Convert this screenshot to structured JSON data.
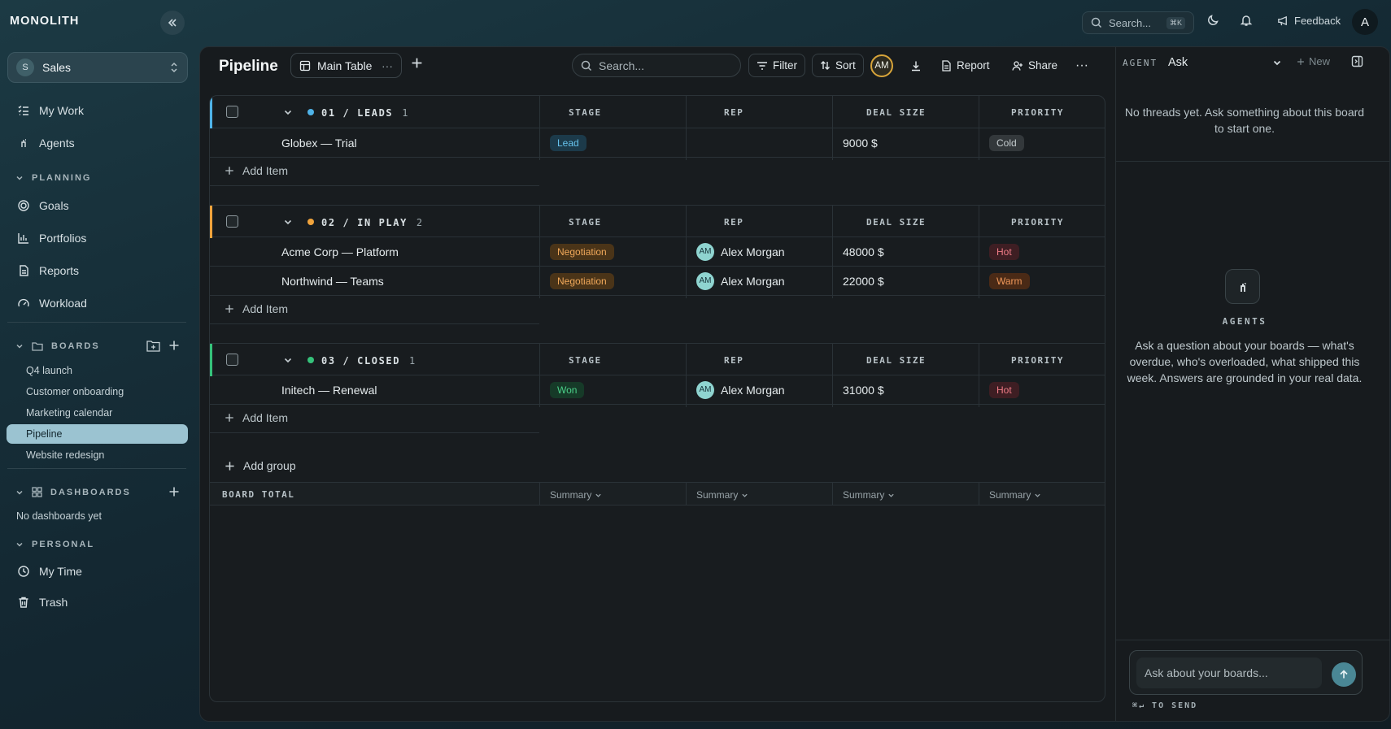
{
  "app": {
    "brand": "MONOLITH"
  },
  "topbar": {
    "search_label": "Search...",
    "search_kbd": "⌘K",
    "feedback": "Feedback",
    "user_initial": "A"
  },
  "sidebar": {
    "workspace": {
      "initial": "S",
      "name": "Sales"
    },
    "nav": [
      {
        "label": "My Work",
        "icon": "list-check-icon"
      },
      {
        "label": "Agents",
        "icon": "agent-icon"
      }
    ],
    "planning": {
      "title": "PLANNING",
      "items": [
        {
          "label": "Goals",
          "icon": "target-icon"
        },
        {
          "label": "Portfolios",
          "icon": "bar-chart-icon"
        },
        {
          "label": "Reports",
          "icon": "document-icon"
        },
        {
          "label": "Workload",
          "icon": "gauge-icon"
        }
      ]
    },
    "boards": {
      "title": "BOARDS",
      "items": [
        "Q4 launch",
        "Customer onboarding",
        "Marketing calendar",
        "Pipeline",
        "Website redesign"
      ],
      "active": "Pipeline"
    },
    "dashboards": {
      "title": "DASHBOARDS",
      "empty": "No dashboards yet"
    },
    "personal": {
      "title": "PERSONAL",
      "items": [
        {
          "label": "My Time",
          "icon": "clock-icon"
        },
        {
          "label": "Trash",
          "icon": "trash-icon"
        }
      ]
    }
  },
  "toolbar": {
    "title": "Pipeline",
    "view": "Main Table",
    "search_placeholder": "Search...",
    "filter": "Filter",
    "sort": "Sort",
    "person_filter": "AM",
    "report": "Report",
    "share": "Share"
  },
  "board": {
    "columns": [
      "STAGE",
      "REP",
      "DEAL SIZE",
      "PRIORITY"
    ],
    "add_item": "Add Item",
    "add_group": "Add group",
    "total_label": "BOARD TOTAL",
    "summary_label": "Summary",
    "groups": [
      {
        "name": "01 / LEADS",
        "count": "1",
        "color": "#4fb3e8",
        "rows": [
          {
            "item": "Globex — Trial",
            "stage": "Lead",
            "rep": "",
            "rep_initials": "",
            "deal": "9000 $",
            "priority": "Cold"
          }
        ]
      },
      {
        "name": "02 / IN PLAY",
        "count": "2",
        "color": "#f0a33c",
        "rows": [
          {
            "item": "Acme Corp — Platform",
            "stage": "Negotiation",
            "rep": "Alex Morgan",
            "rep_initials": "AM",
            "deal": "48000 $",
            "priority": "Hot"
          },
          {
            "item": "Northwind — Teams",
            "stage": "Negotiation",
            "rep": "Alex Morgan",
            "rep_initials": "AM",
            "deal": "22000 $",
            "priority": "Warm"
          }
        ]
      },
      {
        "name": "03 / CLOSED",
        "count": "1",
        "color": "#35c27a",
        "rows": [
          {
            "item": "Initech — Renewal",
            "stage": "Won",
            "rep": "Alex Morgan",
            "rep_initials": "AM",
            "deal": "31000 $",
            "priority": "Hot"
          }
        ]
      }
    ]
  },
  "agent_panel": {
    "label": "AGENT",
    "mode": "Ask",
    "new": "New",
    "empty_threads": "No threads yet. Ask something about this board to start one.",
    "title": "AGENTS",
    "description": "Ask a question about your boards — what's overdue, who's overloaded, what shipped this week. Answers are grounded in your real data.",
    "input_placeholder": "Ask about your boards...",
    "send_hint": "⌘↵ TO SEND"
  },
  "colors": {
    "lead": "#4fb3e8",
    "in_play": "#f0a33c",
    "closed": "#35c27a",
    "accent": "#4a8795"
  }
}
